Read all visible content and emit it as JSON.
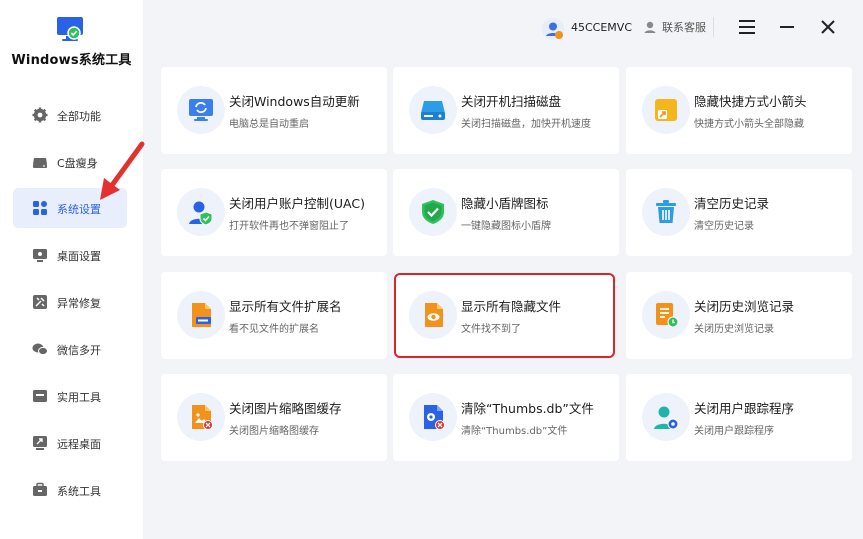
{
  "app": {
    "title": "Windows系统工具"
  },
  "sidebar": {
    "items": [
      {
        "label": "全部功能",
        "icon": "gear-icon"
      },
      {
        "label": "C盘瘦身",
        "icon": "drive-icon"
      },
      {
        "label": "系统设置",
        "icon": "grid-icon",
        "active": true
      },
      {
        "label": "桌面设置",
        "icon": "monitor-icon"
      },
      {
        "label": "异常修复",
        "icon": "repair-icon"
      },
      {
        "label": "微信多开",
        "icon": "chat-icon"
      },
      {
        "label": "实用工具",
        "icon": "toolbox-icon"
      },
      {
        "label": "远程桌面",
        "icon": "remote-desktop-icon"
      },
      {
        "label": "系统工具",
        "icon": "briefcase-icon"
      }
    ]
  },
  "topbar": {
    "user_name": "45CCEMVC",
    "service_label": "联系客服"
  },
  "cards": [
    {
      "title": "关闭Windows自动更新",
      "desc": "电脑总是自动重启",
      "icon": "refresh-monitor-icon"
    },
    {
      "title": "关闭开机扫描磁盘",
      "desc": "关闭扫描磁盘，加快开机速度",
      "icon": "disk-icon"
    },
    {
      "title": "隐藏快捷方式小箭头",
      "desc": "快捷方式小箭头全部隐藏",
      "icon": "shortcut-arrow-icon"
    },
    {
      "title": "关闭用户账户控制(UAC)",
      "desc": "打开软件再也不弹窗阻止了",
      "icon": "user-shield-icon"
    },
    {
      "title": "隐藏小盾牌图标",
      "desc": "一键隐藏图标小盾牌",
      "icon": "shield-check-icon"
    },
    {
      "title": "清空历史记录",
      "desc": "清空历史记录",
      "icon": "trash-icon"
    },
    {
      "title": "显示所有文件扩展名",
      "desc": "看不见文件的扩展名",
      "icon": "file-extension-icon"
    },
    {
      "title": "显示所有隐藏文件",
      "desc": "文件找不到了",
      "icon": "file-eye-icon",
      "highlighted": true
    },
    {
      "title": "关闭历史浏览记录",
      "desc": "关闭历史浏览记录",
      "icon": "doc-history-icon"
    },
    {
      "title": "关闭图片缩略图缓存",
      "desc": "关闭图片缩略图缓存",
      "icon": "image-cache-icon"
    },
    {
      "title": "清除“Thumbs.db”文件",
      "desc": "清除“Thumbs.db”文件",
      "icon": "file-gear-icon"
    },
    {
      "title": "关闭用户跟踪程序",
      "desc": "关闭用户跟踪程序",
      "icon": "user-track-icon"
    }
  ],
  "colors": {
    "accent": "#2a62e6",
    "orange": "#f2911b",
    "highlight_border": "#d9252c",
    "arrow": "#e53030"
  }
}
